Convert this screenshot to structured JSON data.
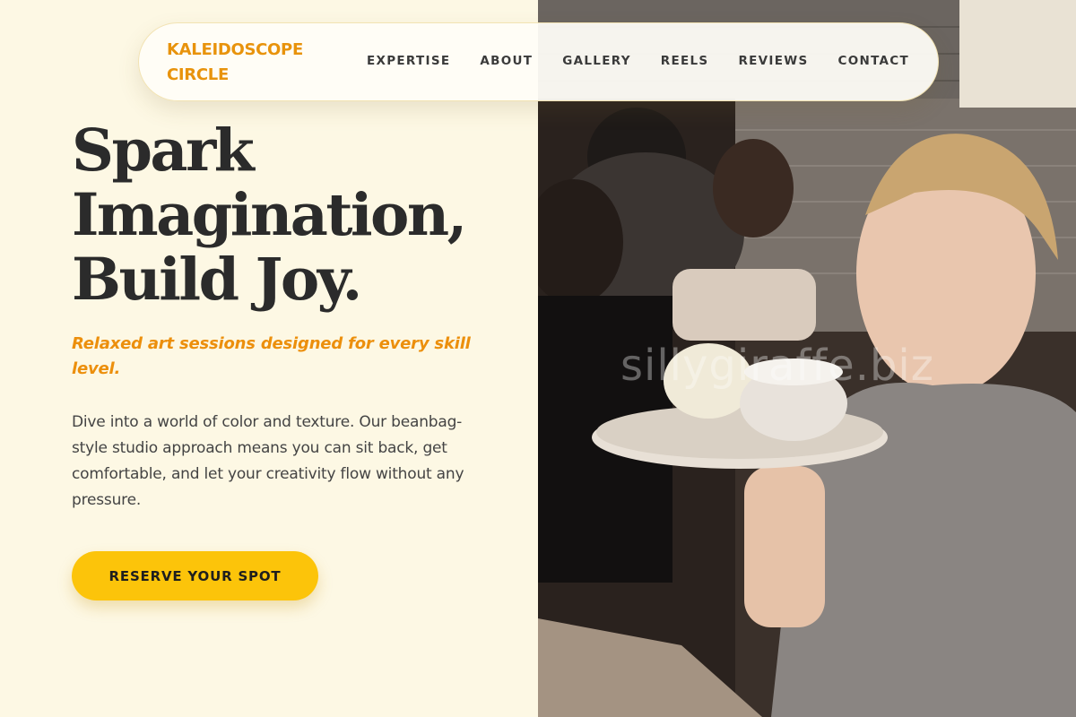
{
  "brand": {
    "line1": "KALEIDOSCOPE",
    "line2": "CIRCLE"
  },
  "nav": {
    "items": [
      {
        "label": "EXPERTISE"
      },
      {
        "label": "ABOUT"
      },
      {
        "label": "GALLERY"
      },
      {
        "label": "REELS"
      },
      {
        "label": "REVIEWS"
      },
      {
        "label": "CONTACT"
      }
    ]
  },
  "hero": {
    "title_lines": [
      "Spark",
      "Imagination,",
      "Build Joy."
    ],
    "tagline": "Relaxed art sessions designed for every skill level.",
    "body": "Dive into a world of color and texture. Our beanbag-style studio approach means you can sit back, get comfortable, and let your creativity flow without any pressure.",
    "cta_label": "RESERVE YOUR SPOT"
  },
  "photo": {
    "watermark": "sillygiraffe.biz",
    "description_icon": "pottery-class-photo"
  },
  "colors": {
    "background": "#fdf8e4",
    "accent_orange": "#ec8f0c",
    "cta_yellow": "#fcc40a",
    "text_dark": "#2b2b2b"
  }
}
